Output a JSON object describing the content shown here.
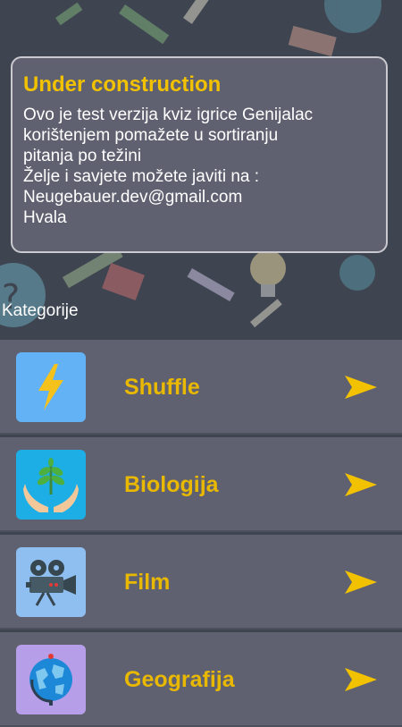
{
  "notice": {
    "title": "Under construction",
    "body": "Ovo je test verzija kviz igrice Genijalac\n korištenjem pomažete u sortiranju\npitanja po težini\n Želje i savjete možete javiti na :\n Neugebauer.dev@gmail.com\n Hvala"
  },
  "section_label": "Kategorije",
  "categories": [
    {
      "label": "Shuffle",
      "icon": "lightning-icon",
      "icon_bg": "#62b2f5"
    },
    {
      "label": "Biologija",
      "icon": "plant-hands-icon",
      "icon_bg": "#1eaee6"
    },
    {
      "label": "Film",
      "icon": "film-camera-icon",
      "icon_bg": "#8fbff0"
    },
    {
      "label": "Geografija",
      "icon": "globe-icon",
      "icon_bg": "#b79ee8"
    }
  ],
  "colors": {
    "accent": "#e9b800",
    "card": "#5f6170",
    "background": "#3e4551"
  }
}
